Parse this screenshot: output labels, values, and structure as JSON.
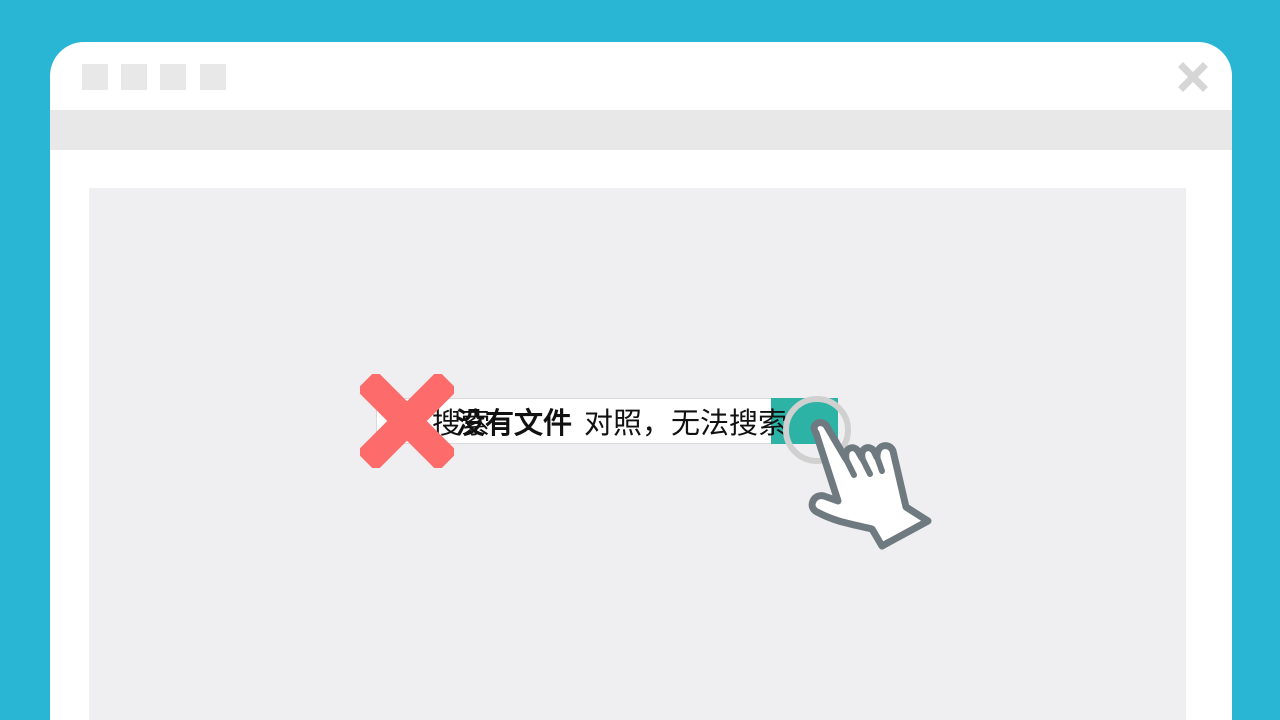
{
  "window": {
    "title_buttons": [
      "window-button",
      "window-button",
      "window-button",
      "window-button"
    ],
    "close_icon": "close-icon"
  },
  "search": {
    "overlay_text_1": "搜索",
    "overlay_text_2": "没有文件",
    "overlay_text_3": "对照，无法搜索",
    "button_label": "",
    "button_icon": "search-icon"
  },
  "colors": {
    "background": "#29b6d4",
    "accent": "#2db3a6",
    "error": "#fd6b6b",
    "hand": "#6f7a80"
  },
  "icons": {
    "error_mark": "red-x-icon",
    "pointer": "hand-pointer-icon"
  }
}
